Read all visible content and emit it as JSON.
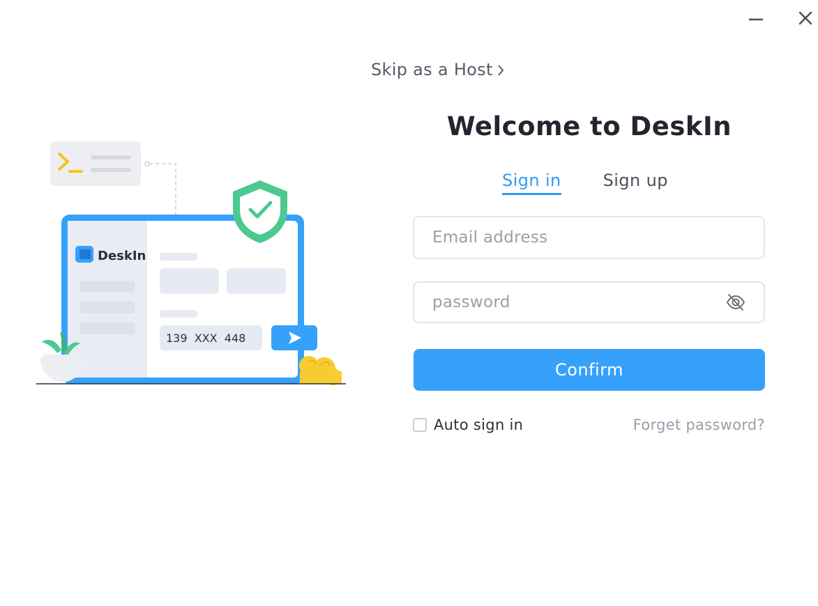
{
  "window": {
    "minimize_icon": "minus-icon",
    "close_icon": "close-icon"
  },
  "skip_host": {
    "label": "Skip as a Host",
    "icon": "chevron-right-icon"
  },
  "illustration": {
    "brand": "DeskIn",
    "device_code": "139  XXX  448",
    "icons": [
      "terminal-icon",
      "shield-check-icon",
      "play-icon",
      "plant-icon",
      "bush-icon"
    ]
  },
  "title": "Welcome to DeskIn",
  "tabs": [
    {
      "label": "Sign in",
      "active": true
    },
    {
      "label": "Sign up",
      "active": false
    }
  ],
  "form": {
    "email": {
      "value": "",
      "placeholder": "Email address"
    },
    "password": {
      "value": "",
      "placeholder": "password",
      "toggle_icon": "eye-off-icon"
    },
    "confirm_label": "Confirm",
    "auto_sign_in": {
      "label": "Auto sign in",
      "checked": false
    },
    "forget_label": "Forget password?"
  },
  "colors": {
    "accent": "#36a1fb",
    "tab_active": "#2f9bf5",
    "shield": "#4cc98f",
    "terminal": "#f5c518",
    "bush": "#f7cc30"
  }
}
